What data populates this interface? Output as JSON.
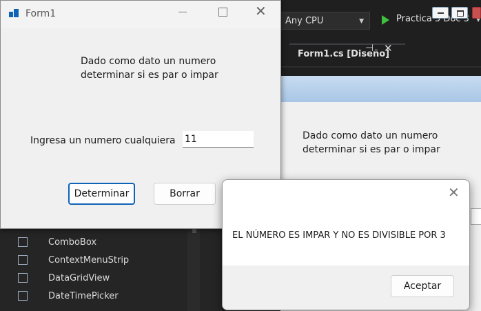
{
  "vs": {
    "platform_dropdown": "Any CPU",
    "run_target": "Practica 5 Doc 3",
    "doc_tab": "Form1.cs [Diseño]",
    "designer_description": "Dado como dato un numero determinar si es par o impar"
  },
  "toolbox": {
    "items": [
      {
        "label": "ComboBox",
        "icon": "combobox-icon"
      },
      {
        "label": "ContextMenuStrip",
        "icon": "contextmenustrip-icon"
      },
      {
        "label": "DataGridView",
        "icon": "datagridview-icon"
      },
      {
        "label": "DateTimePicker",
        "icon": "datetimepicker-icon"
      }
    ]
  },
  "form1": {
    "title": "Form1",
    "description": "Dado como dato un numero determinar si es par o impar",
    "input_label": "Ingresa un numero cualquiera",
    "input_value": "11",
    "determinar_label": "Determinar",
    "borrar_label": "Borrar"
  },
  "msgbox": {
    "message": "EL NÚMERO ES IMPAR Y NO ES DIVISIBLE POR 3",
    "ok_label": "Aceptar"
  },
  "colors": {
    "accent": "#0f63b6",
    "run_green": "#3fc13f"
  }
}
